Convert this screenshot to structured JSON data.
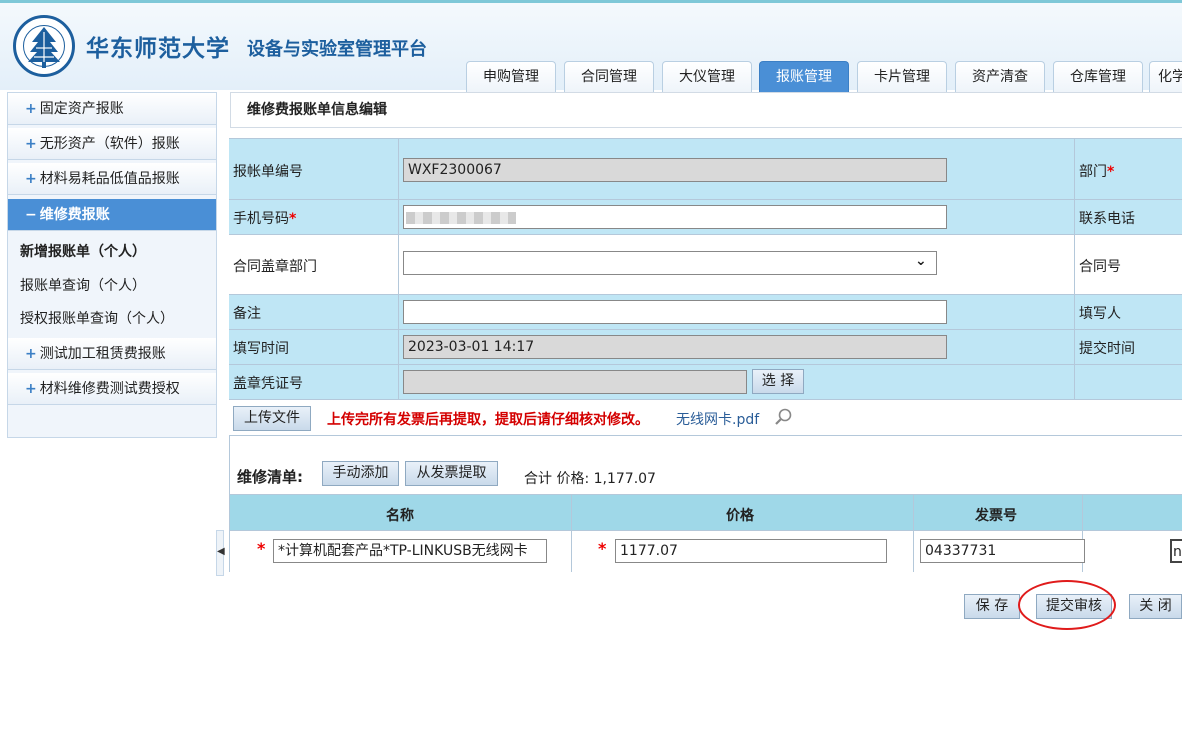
{
  "header": {
    "university": "华东师范大学",
    "platform": "设备与实验室管理平台",
    "tabs": [
      "申购管理",
      "合同管理",
      "大仪管理",
      "报账管理",
      "卡片管理",
      "资产清查",
      "仓库管理",
      "化学"
    ],
    "active_tab": "报账管理",
    "colors": {
      "brand": "#1d5f9e",
      "active": "#4a8fd6"
    }
  },
  "sidebar": {
    "menus": [
      {
        "label": "固定资产报账"
      },
      {
        "label": "无形资产（软件）报账"
      },
      {
        "label": "材料易耗品低值品报账"
      },
      {
        "label": "维修费报账"
      },
      {
        "label": "测试加工租赁费报账"
      },
      {
        "label": "材料维修费测试费授权"
      }
    ],
    "sub_items": [
      "新增报账单（个人）",
      "报账单查询（个人）",
      "授权报账单查询（个人）"
    ]
  },
  "form": {
    "title": "维修费报账单信息编辑",
    "labels": {
      "bill_no": "报帐单编号",
      "phone": "手机号码",
      "seal_dept": "合同盖章部门",
      "remark": "备注",
      "fill_time": "填写时间",
      "seal_no": "盖章凭证号",
      "dept": "部门",
      "contact": "联系电话",
      "contract_no": "合同号",
      "filler": "填写人",
      "submit_time": "提交时间"
    },
    "required_mark": "*",
    "values": {
      "bill_no": "WXF2300067",
      "phone": "",
      "seal_dept": "",
      "remark": "",
      "fill_time": "2023-03-01 14:17",
      "seal_no": ""
    },
    "select_button": "选 择",
    "upload_button": "上传文件",
    "upload_tip": "上传完所有发票后再提取，提取后请仔细核对修改。",
    "file_link": "无线网卡.pdf"
  },
  "repair_list": {
    "label": "维修清单:",
    "manual_add": "手动添加",
    "extract_invoice": "从发票提取",
    "total_label": "合计 价格: 1,177.07",
    "columns": [
      "名称",
      "价格",
      "发票号"
    ],
    "rows": [
      {
        "name": "*计算机配套产品*TP-LINKUSB无线网卡",
        "price": "1177.07",
        "invoice": "04337731",
        "extra": "n"
      }
    ]
  },
  "actions": {
    "save": "保 存",
    "submit": "提交审核",
    "close": "关 闭"
  }
}
